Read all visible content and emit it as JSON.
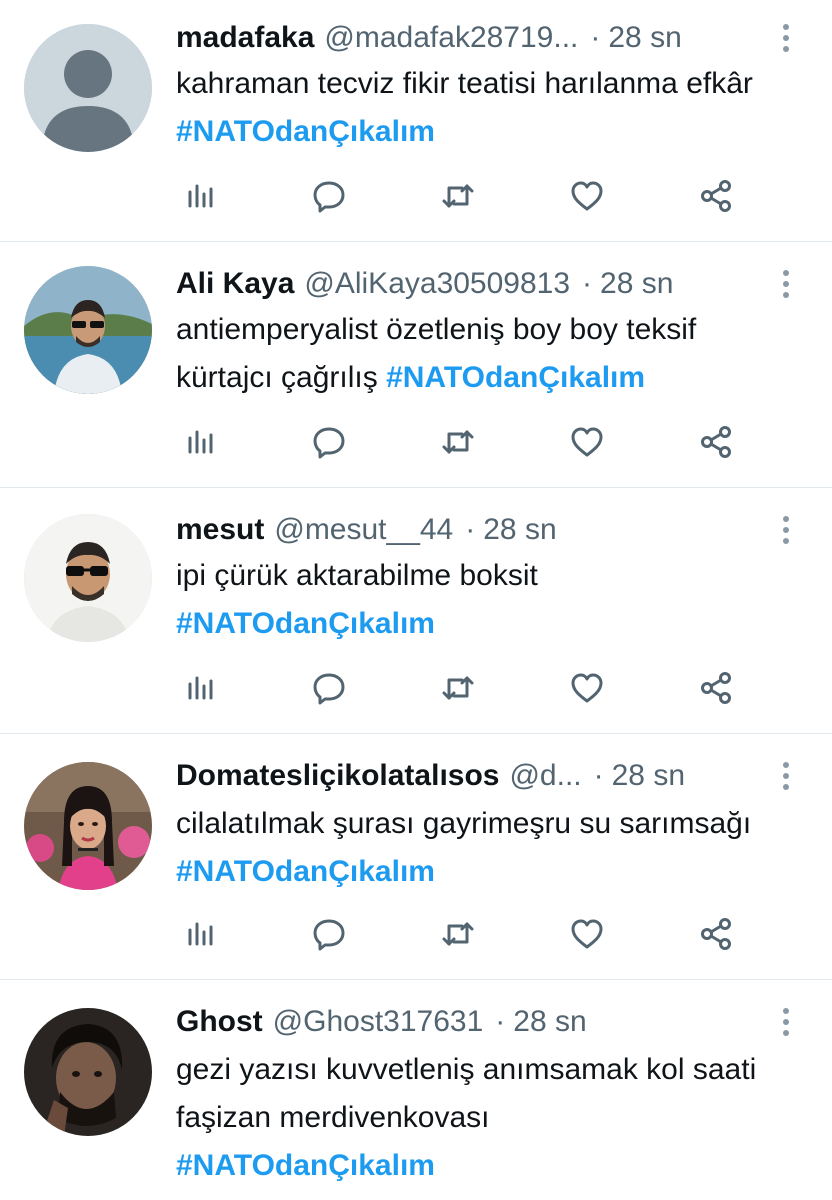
{
  "tweets": [
    {
      "name": "madafaka",
      "handle": "@madafak28719...",
      "dot": "·",
      "time": "28 sn",
      "text": "kahraman tecviz fikir teatisi harılanma efkâr",
      "hashtag": "#NATOdanÇıkalım",
      "avatar": "default-avatar"
    },
    {
      "name": "Ali Kaya",
      "handle": "@AliKaya30509813",
      "dot": "·",
      "time": "28 sn",
      "text": "antiemperyalist özetleniş boy boy teksif kürtajcı çağrılış",
      "hashtag": "#NATOdanÇıkalım",
      "avatar": "photo-man-sunglasses-sea"
    },
    {
      "name": "mesut",
      "handle": "@mesut__44",
      "dot": "·",
      "time": "28 sn",
      "text": "ipi çürük aktarabilme boksit",
      "hashtag": "#NATOdanÇıkalım",
      "avatar": "photo-man-sunglasses-white"
    },
    {
      "name": "Domatesliçikolatalısos",
      "handle": "@d...",
      "dot": "·",
      "time": "28 sn",
      "text": "cilalatılmak şurası gayrimeşru su sarımsağı",
      "hashtag": "#NATOdanÇıkalım",
      "avatar": "photo-woman-pink"
    },
    {
      "name": "Ghost",
      "handle": "@Ghost317631",
      "dot": "·",
      "time": "28 sn",
      "text": "gezi yazısı kuvvetleniş anımsamak kol saati faşizan merdivenkovası",
      "hashtag": "#NATOdanÇıkalım",
      "avatar": "photo-man-dark"
    }
  ],
  "icons": {
    "views": "views-icon",
    "reply": "reply-icon",
    "retweet": "retweet-icon",
    "like": "like-icon",
    "share": "share-icon",
    "more": "more-icon"
  },
  "colors": {
    "hashtag": "#1d9bf0",
    "secondary_text": "#536471",
    "icon": "#536471",
    "divider": "#e1e8ed"
  }
}
